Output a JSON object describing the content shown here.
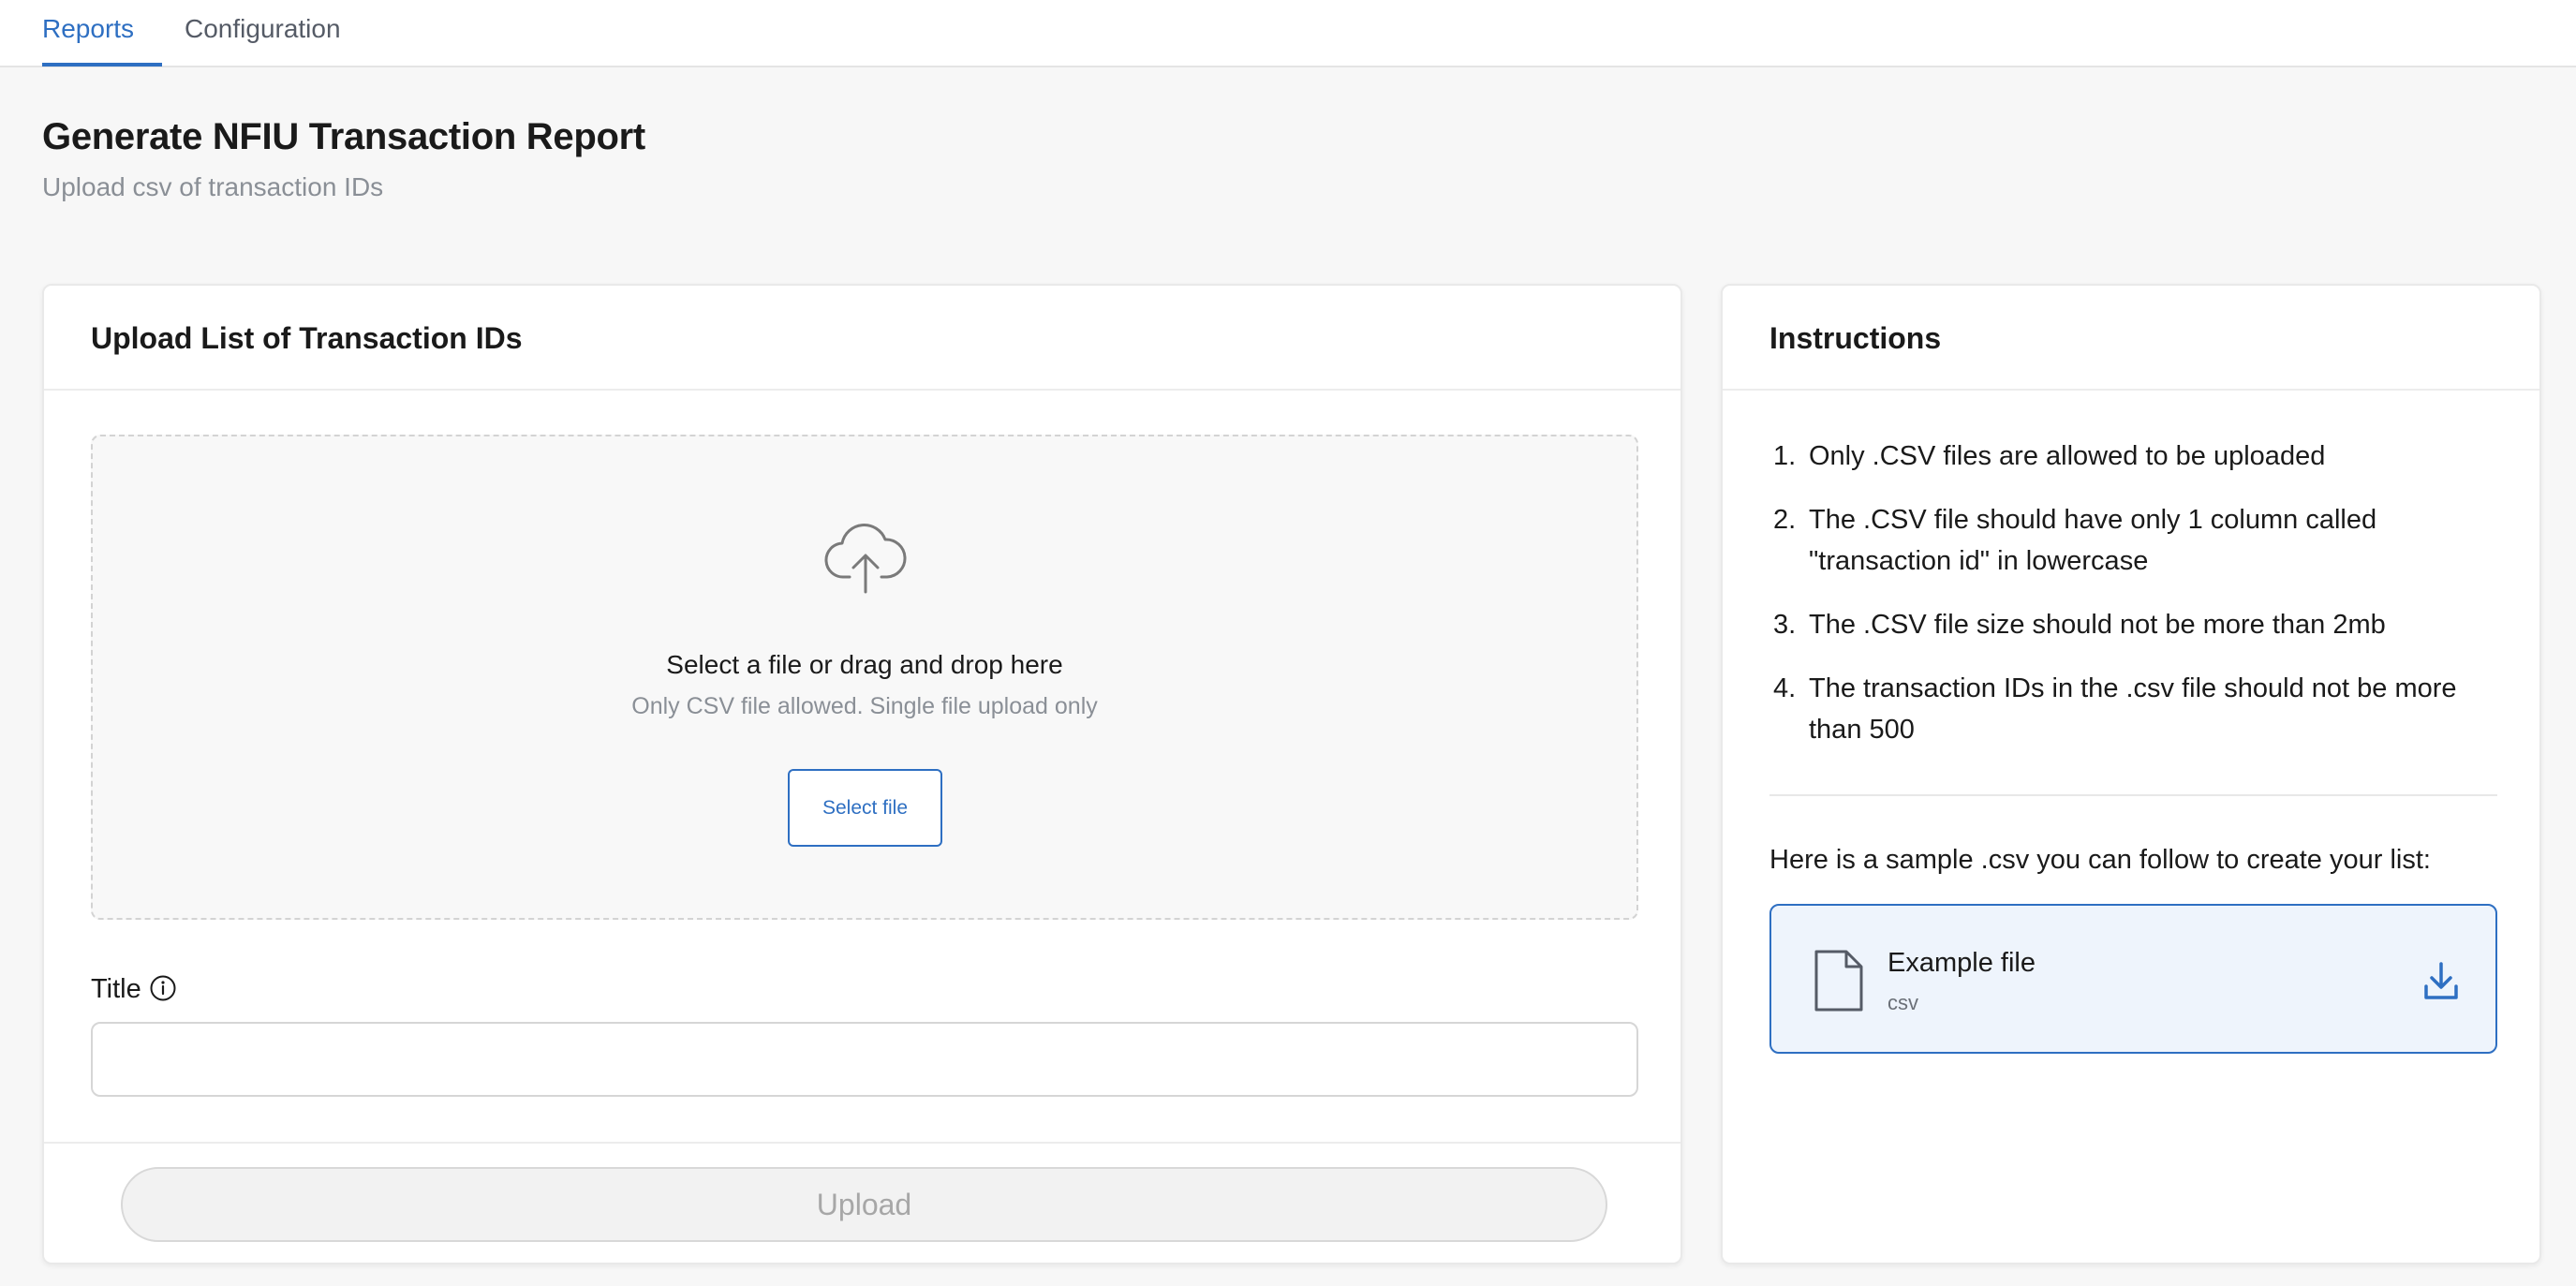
{
  "tabs": [
    {
      "label": "Reports",
      "active": true
    },
    {
      "label": "Configuration",
      "active": false
    }
  ],
  "page": {
    "title": "Generate NFIU Transaction Report",
    "subtitle": "Upload csv of transaction IDs"
  },
  "upload_card": {
    "title": "Upload List of Transaction IDs",
    "dropzone": {
      "icon": "cloud-upload-icon",
      "text": "Select a file or drag and drop here",
      "hint": "Only CSV file allowed. Single file upload only",
      "button_label": "Select file"
    },
    "title_field": {
      "label": "Title",
      "icon": "info-icon",
      "value": "",
      "placeholder": ""
    },
    "upload_button_label": "Upload"
  },
  "instructions_card": {
    "title": "Instructions",
    "items": [
      {
        "num": "1.",
        "text": "Only .CSV files are allowed to be uploaded"
      },
      {
        "num": "2.",
        "text": "The .CSV file should have only 1 column called \"transaction id\" in lowercase"
      },
      {
        "num": "3.",
        "text": "The .CSV file size should not be more than 2mb"
      },
      {
        "num": "4.",
        "text": "The transaction IDs in the .csv file should not be more than 500"
      }
    ],
    "sample_text": "Here is a sample .csv you can follow to create your list:",
    "example_file": {
      "name": "Example file",
      "type": "csv",
      "icon": "file-icon",
      "action_icon": "download-icon"
    }
  },
  "colors": {
    "accent": "#2e6fc2",
    "background": "#f7f7f7",
    "card": "#ffffff",
    "example_card_bg": "#eef4fc"
  }
}
